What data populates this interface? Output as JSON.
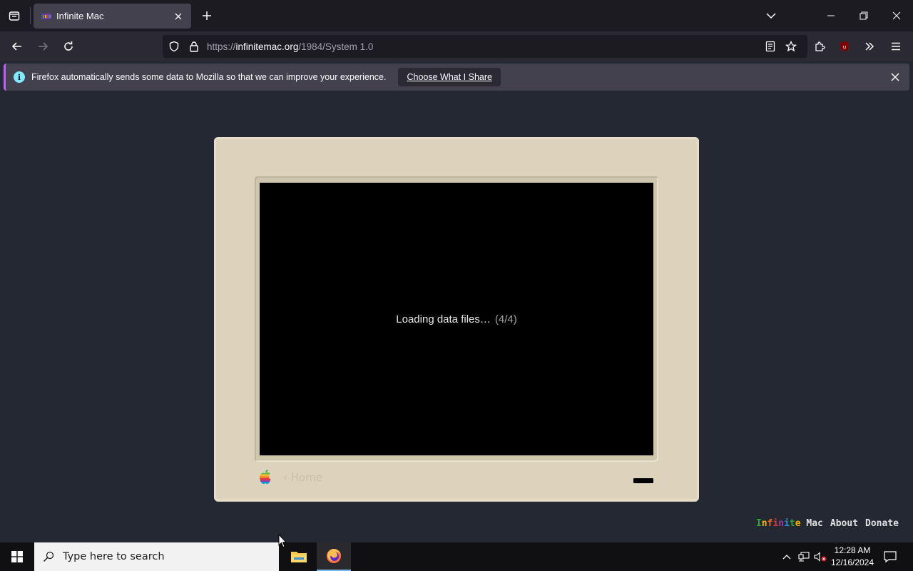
{
  "browser": {
    "tab": {
      "title": "Infinite Mac"
    },
    "url": {
      "prefix": "https://",
      "host": "infinitemac.org",
      "path": "/1984/System 1.0"
    },
    "extension_badge": "1"
  },
  "notification": {
    "text": "Firefox automatically sends some data to Mozilla so that we can improve your experience.",
    "button": "Choose What I Share"
  },
  "page": {
    "loading_text": "Loading data files…",
    "loading_count": "(4/4)",
    "home_link": "‹ Home",
    "footer": {
      "brand_first": "Infinite",
      "brand_second": "Mac",
      "about": "About",
      "donate": "Donate"
    }
  },
  "taskbar": {
    "search_placeholder": "Type here to search",
    "time": "12:28 AM",
    "date": "12/16/2024"
  },
  "colors": {
    "tab_bg": "#42414d",
    "page_bg": "#232833",
    "mac_case": "#ddd3bd",
    "accent": "#c060ff"
  }
}
